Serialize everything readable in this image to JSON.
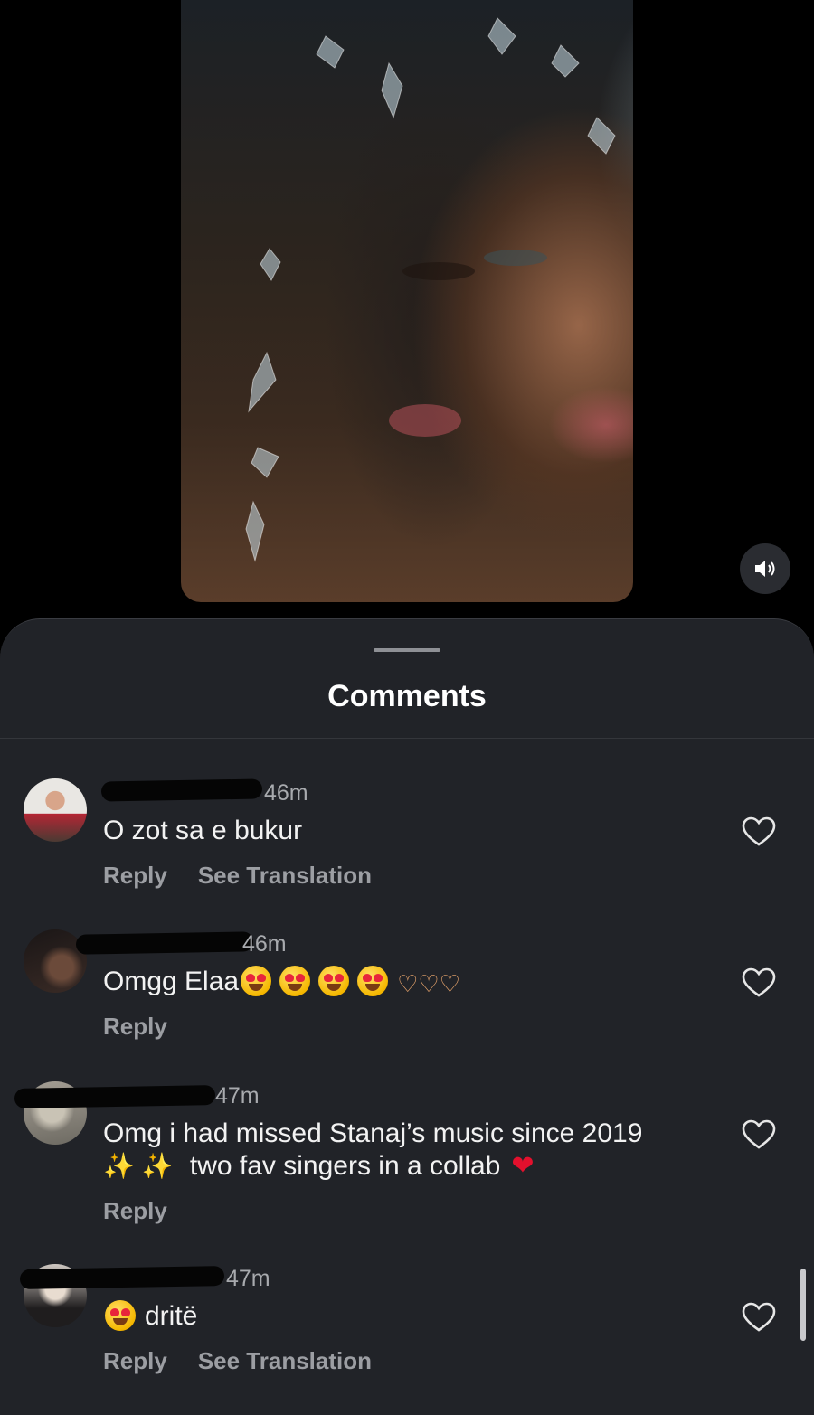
{
  "sheet": {
    "title": "Comments"
  },
  "comments": [
    {
      "time": "46m",
      "text": "O zot sa e bukur",
      "actions": [
        "Reply",
        "See Translation"
      ]
    },
    {
      "time": "46m",
      "text": "Omgg Elaa",
      "actions": [
        "Reply"
      ]
    },
    {
      "time": "47m",
      "text_line1": "Omg i had missed Stanaj’s music since 2019",
      "text_line2": "two fav singers in a collab",
      "actions": [
        "Reply"
      ]
    },
    {
      "time": "47m",
      "text": "dritë",
      "actions": [
        "Reply",
        "See Translation"
      ]
    }
  ],
  "icons": {
    "sound": "speaker-on-icon",
    "like": "heart-outline-icon"
  },
  "colors": {
    "sheet_bg": "#212328",
    "secondary_text": "#9c9ea3"
  }
}
